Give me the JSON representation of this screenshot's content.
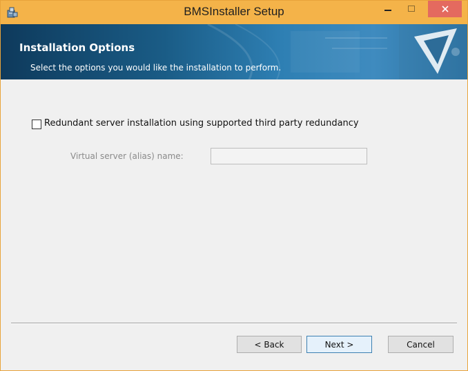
{
  "window": {
    "title": "BMSInstaller Setup",
    "colors": {
      "titlebar": "#f4b349",
      "close": "#e46a5f",
      "border": "#e8a33a"
    }
  },
  "titlebar_icons": [
    "installer-app-icon",
    "minimize-icon",
    "maximize-icon",
    "close-icon"
  ],
  "header": {
    "title": "Installation Options",
    "subtitle": "Select the options you would like the installation to perform."
  },
  "options": {
    "redundant_checkbox_label": "Redundant server installation using supported third party redundancy",
    "redundant_checked": false,
    "virtual_server_label": "Virtual server (alias) name:",
    "virtual_server_value": ""
  },
  "buttons": {
    "back": "< Back",
    "next": "Next >",
    "cancel": "Cancel"
  }
}
